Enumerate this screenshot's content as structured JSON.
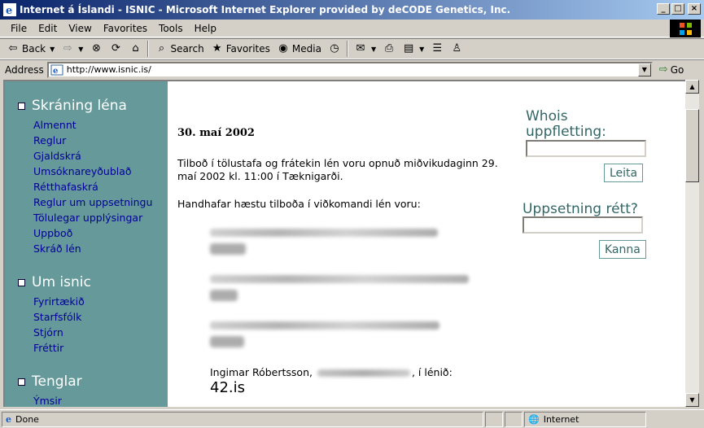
{
  "window": {
    "title": "Internet á Íslandi - ISNIC - Microsoft Internet Explorer provided by deCODE Genetics, Inc.",
    "buttons": [
      "_",
      "□",
      "×"
    ]
  },
  "menu": [
    "File",
    "Edit",
    "View",
    "Favorites",
    "Tools",
    "Help"
  ],
  "toolbar": {
    "back": "Back",
    "search": "Search",
    "favorites": "Favorites",
    "media": "Media"
  },
  "address": {
    "label": "Address",
    "url": "http://www.isnic.is/",
    "go": "Go"
  },
  "sidebar": {
    "sections": [
      {
        "heading": "Skráning léna",
        "links": [
          "Almennt",
          "Reglur",
          "Gjaldskrá",
          "Umsóknareyðublað",
          "Rétthafaskrá",
          "Reglur um uppsetningu",
          "Tölulegar upplýsingar",
          "Uppboð",
          "Skráð lén"
        ]
      },
      {
        "heading": "Um isnic",
        "links": [
          "Fyrirtækið",
          "Starfsfólk",
          "Stjórn",
          "Fréttir"
        ]
      },
      {
        "heading": "Tenglar",
        "links": [
          "Ýmsir"
        ]
      }
    ]
  },
  "main": {
    "date": "30. maí 2002",
    "para1": "Tilboð í tölustafa og frátekin lén voru opnuð miðvikudaginn 29. maí 2002 kl. 11:00 í Tæknigarði.",
    "para2": "Handhafar hæstu tilboða í viðkomandi lén voru:",
    "last_entry_name": "Ingimar Róbertsson,",
    "last_entry_suffix": ", í lénið:",
    "last_entry_domain": "42.is"
  },
  "right": {
    "whois_title": "Whois uppfletting:",
    "whois_button": "Leita",
    "setup_title": "Uppsetning rétt?",
    "setup_button": "Kanna"
  },
  "status": {
    "text": "Done",
    "zone": "Internet"
  },
  "colors": {
    "sidebar_bg": "#669999",
    "link": "#000099",
    "accent": "#336666",
    "title_bar": "#0a246a"
  }
}
